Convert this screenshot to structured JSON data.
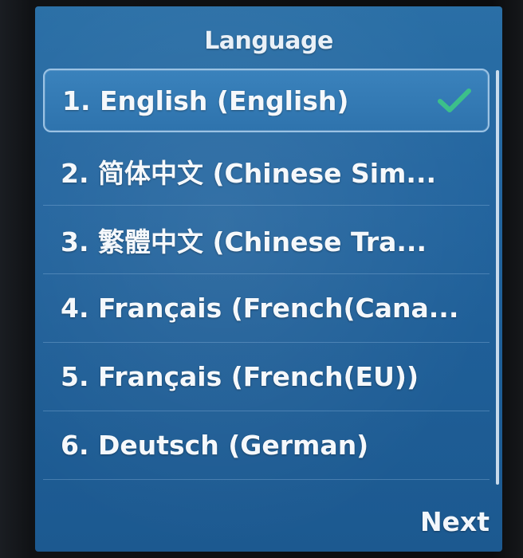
{
  "screen": {
    "title": "Language",
    "softkey_next": "Next"
  },
  "languages": {
    "items": [
      {
        "label": "1. English (English)",
        "selected": true
      },
      {
        "label": "2. 简体中文 (Chinese Sim...",
        "selected": false
      },
      {
        "label": "3. 繁體中文 (Chinese Tra...",
        "selected": false
      },
      {
        "label": "4. Français (French(Cana...",
        "selected": false
      },
      {
        "label": "5. Français (French(EU))",
        "selected": false
      },
      {
        "label": "6. Deutsch (German)",
        "selected": false
      }
    ],
    "selected_check_icon": "checkmark-icon"
  },
  "colors": {
    "screen_background": "#2466a0",
    "selected_row": "#3a82bc",
    "check_mark": "#3cc08a"
  }
}
